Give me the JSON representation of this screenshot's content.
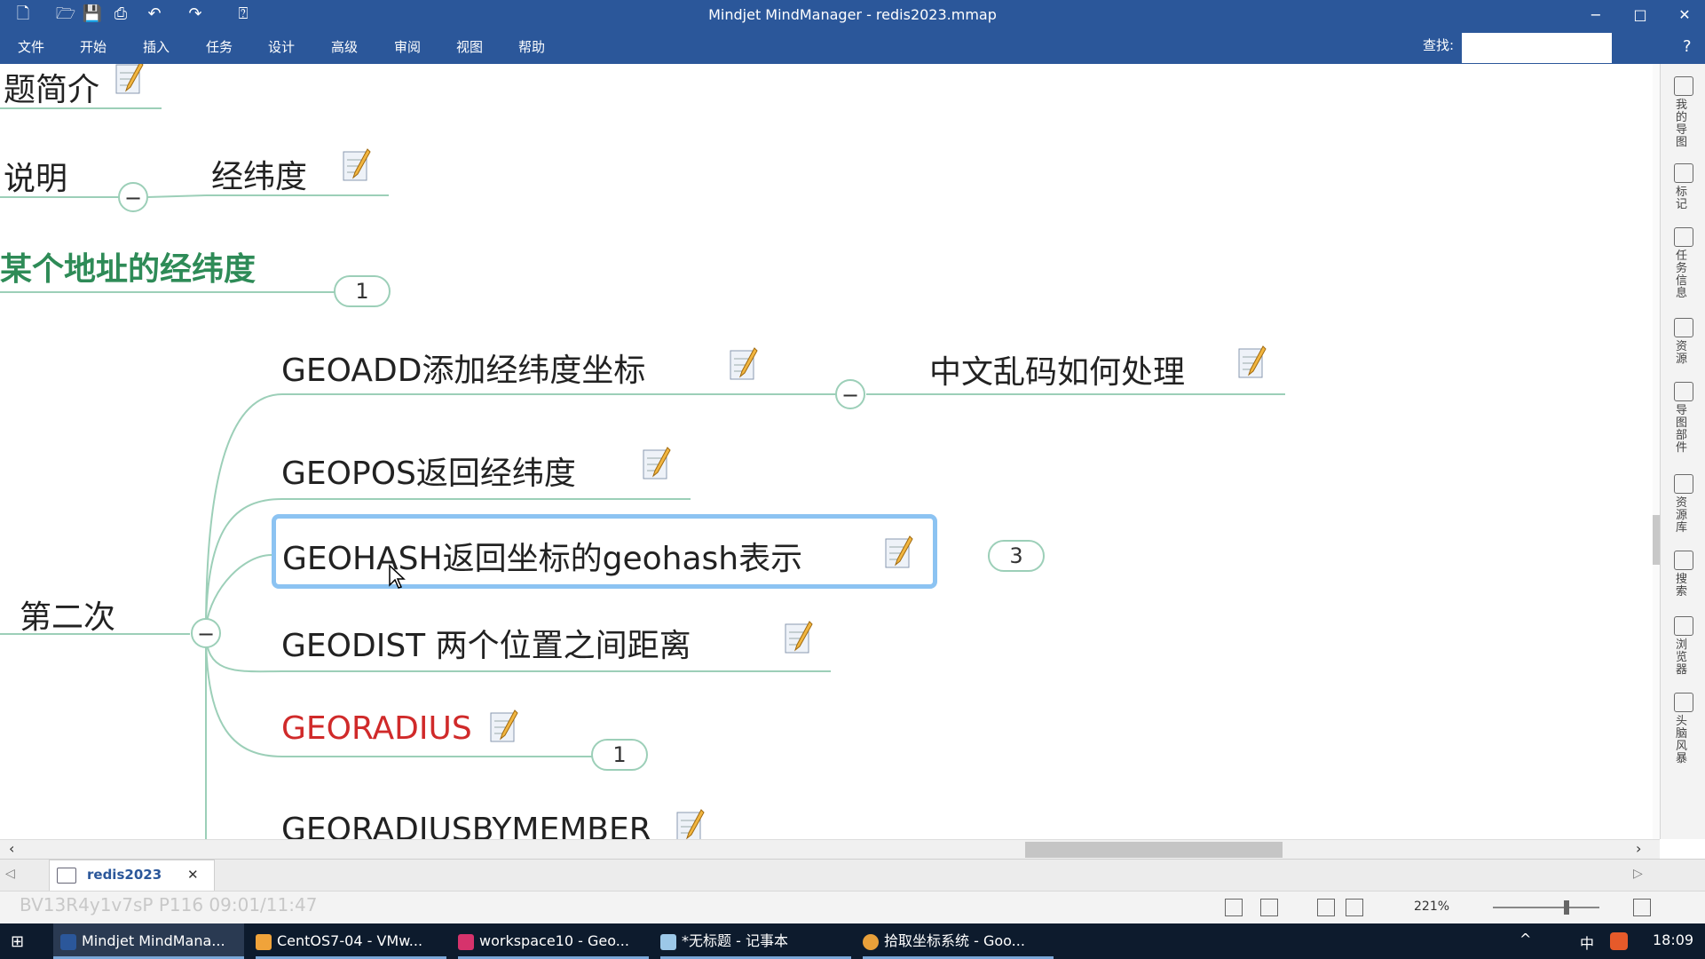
{
  "window": {
    "title": "Mindjet MindManager - redis2023.mmap",
    "minimize": "−",
    "maximize": "□",
    "close": "✕"
  },
  "ribbon": {
    "menus": [
      "文件",
      "开始",
      "插入",
      "任务",
      "设计",
      "高级",
      "审阅",
      "视图",
      "帮助"
    ],
    "search_label": "查找:",
    "help": "?"
  },
  "mindmap": {
    "partial_top": "题简介",
    "partial_explain": "说明",
    "latlng": "经纬度",
    "address_latlng": "某个地址的经纬度",
    "address_badge": "1",
    "branch": "第二次",
    "geoadd": "GEOADD添加经纬度坐标",
    "chinese_garbled": "中文乱码如何处理",
    "geopos": "GEOPOS返回经纬度",
    "geohash": "GEOHASH返回坐标的geohash表示",
    "geohash_badge": "3",
    "geodist": "GEODIST 两个位置之间距离",
    "georadius": "GEORADIUS",
    "georadius_badge": "1",
    "georadiusbymember": "GEORADIUSBYMEMBER",
    "collapse": "−"
  },
  "sidepanel": {
    "items": [
      "我的导图",
      "标记",
      "任务信息",
      "资源",
      "导图部件",
      "资源库",
      "搜索",
      "浏览器",
      "头脑风暴"
    ]
  },
  "tabs": {
    "doc_tab": "redis2023",
    "close": "✕"
  },
  "status": {
    "zoom": "221%",
    "watermark": "BV13R4y1v7sP P116 09:01/11:47"
  },
  "taskbar": {
    "items": [
      "Mindjet MindMana...",
      "CentOS7-04 - VMw...",
      "workspace10 - Geo...",
      "*无标题 - 记事本",
      "拾取坐标系统 - Goo..."
    ],
    "ime": "中",
    "clock": "18:09"
  },
  "colors": {
    "title_blue": "#2b579a",
    "line_green": "#9ccfb8",
    "green_text": "#2e8b57",
    "red_text": "#d02a2a",
    "selection": "#8cc3f2"
  }
}
